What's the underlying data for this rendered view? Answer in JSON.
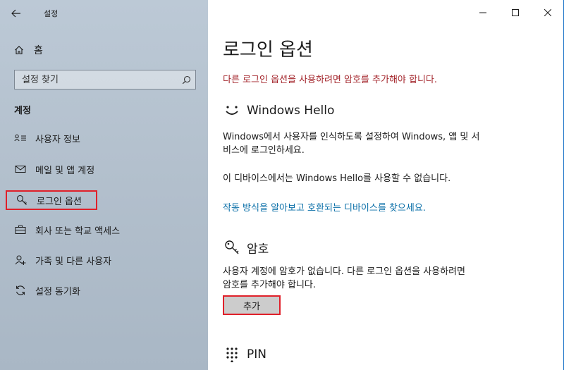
{
  "window": {
    "title": "설정",
    "controls": {
      "minimize": "–",
      "maximize": "☐",
      "close": "✕"
    }
  },
  "sidebar": {
    "home": "홈",
    "search_placeholder": "설정 찾기",
    "section": "계정",
    "items": [
      {
        "label": "사용자 정보",
        "icon": "user-info-icon"
      },
      {
        "label": "메일 및 앱 계정",
        "icon": "mail-icon"
      },
      {
        "label": "로그인 옵션",
        "icon": "key-icon",
        "active": true
      },
      {
        "label": "회사 또는 학교 액세스",
        "icon": "briefcase-icon"
      },
      {
        "label": "가족 및 다른 사용자",
        "icon": "add-person-icon"
      },
      {
        "label": "설정 동기화",
        "icon": "sync-icon"
      }
    ]
  },
  "main": {
    "title": "로그인 옵션",
    "warning": "다른 로그인 옵션을 사용하려면 암호를 추가해야 합니다.",
    "hello": {
      "title": "Windows Hello",
      "desc_line1": "Windows에서 사용자를 인식하도록 설정하여 Windows, 앱 및 서",
      "desc_line2": "비스에 로그인하세요.",
      "unavailable": "이 디바이스에서는 Windows Hello를 사용할 수 없습니다.",
      "link": "작동 방식을 알아보고 호환되는 디바이스를 찾으세요."
    },
    "password": {
      "title": "암호",
      "desc_line1": "사용자 계정에 암호가 없습니다. 다른 로그인 옵션을 사용하려면",
      "desc_line2": "암호를 추가해야 합니다.",
      "add_button": "추가"
    },
    "pin": {
      "title": "PIN"
    }
  },
  "colors": {
    "warning": "#a4262c",
    "link": "#0a6fa8",
    "highlight": "#e0202a"
  }
}
